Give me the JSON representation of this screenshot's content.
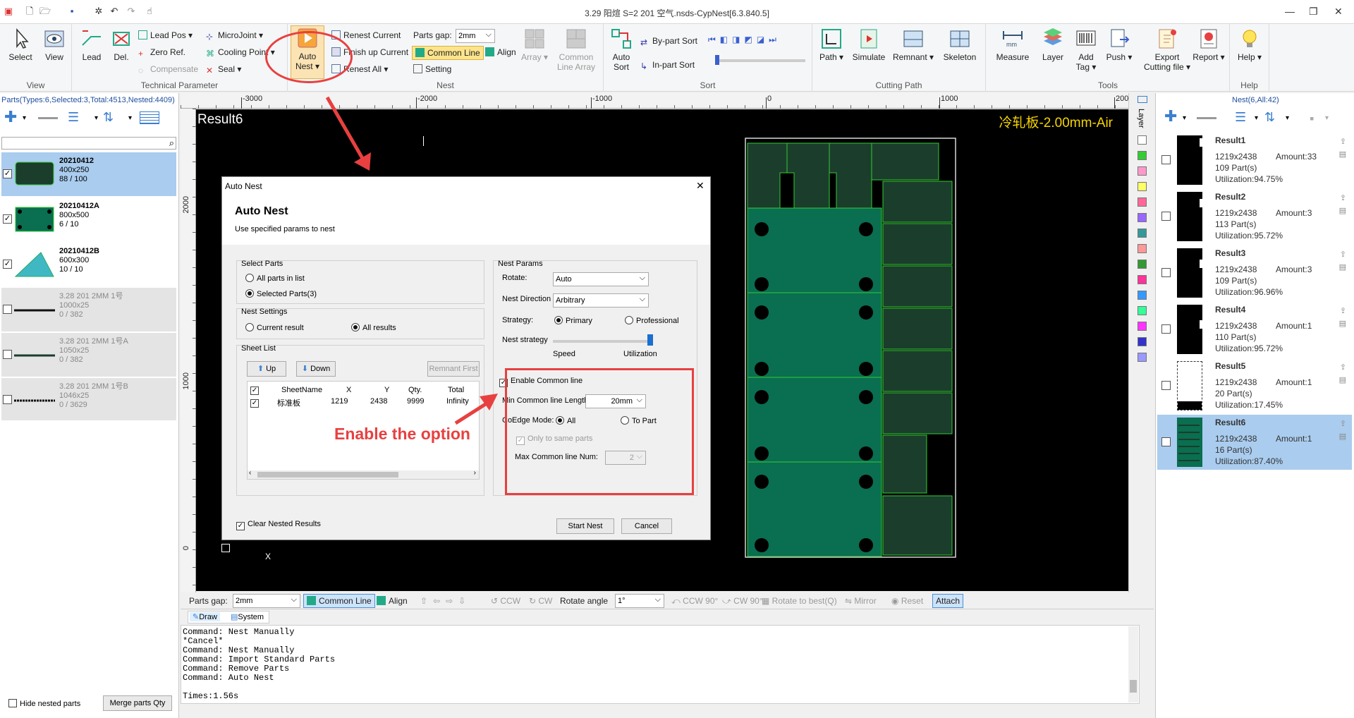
{
  "title": "3.29 阳煊 S=2 201 空气.nsds-CypNest[6.3.840.5]",
  "ribbon": {
    "view": {
      "label": "View",
      "select": "Select",
      "view": "View"
    },
    "tech": {
      "label": "Technical Parameter",
      "lead": "Lead",
      "del": "Del.",
      "lead_pos": "Lead Pos",
      "zero_ref": "Zero Ref.",
      "compensate": "Compensate",
      "microjoint": "MicroJoint",
      "cooling_point": "Cooling Point",
      "seal": "Seal"
    },
    "nest": {
      "label": "Nest",
      "auto_nest_1": "Auto",
      "auto_nest_2": "Nest",
      "renest_current": "Renest Current",
      "finish_up_current": "Finish up Current",
      "renest_all": "Renest All",
      "parts_gap_label": "Parts gap:",
      "parts_gap_value": "2mm",
      "common_line": "Common Line",
      "align": "Align",
      "setting": "Setting",
      "array": "Array",
      "common_line_array_1": "Common",
      "common_line_array_2": "Line Array"
    },
    "sort": {
      "label": "Sort",
      "auto_sort_1": "Auto",
      "auto_sort_2": "Sort",
      "by_part_sort": "By-part Sort",
      "in_part_sort": "In-part Sort"
    },
    "cutting": {
      "label": "Cutting Path",
      "path": "Path",
      "simulate": "Simulate",
      "remnant": "Remnant",
      "skeleton": "Skeleton"
    },
    "tools": {
      "label": "Tools",
      "measure": "Measure",
      "layer": "Layer",
      "add_tag_1": "Add",
      "add_tag_2": "Tag",
      "push": "Push",
      "export_1": "Export",
      "export_2": "Cutting file"
    },
    "report": {
      "report": "Report"
    },
    "help": {
      "label": "Help",
      "help": "Help"
    }
  },
  "left_panel": {
    "header": "Parts(Types:6,Selected:3,Total:4513,Nested:4409)",
    "parts": [
      {
        "name": "20210412",
        "size": "400x250",
        "count": "88 / 100",
        "checked": true,
        "selected": true
      },
      {
        "name": "20210412A",
        "size": "800x500",
        "count": "6 / 10",
        "checked": true,
        "selected": false
      },
      {
        "name": "20210412B",
        "size": "600x300",
        "count": "10 / 10",
        "checked": true,
        "selected": false
      },
      {
        "name": "3.28 201 2MM 1号",
        "size": "1000x25",
        "count": "0 / 382",
        "checked": false,
        "selected": false
      },
      {
        "name": "3.28 201 2MM 1号A",
        "size": "1050x25",
        "count": "0 / 382",
        "checked": false,
        "selected": false
      },
      {
        "name": "3.28 201 2MM 1号B",
        "size": "1046x25",
        "count": "0 / 3629",
        "checked": false,
        "selected": false
      }
    ],
    "hide_nested": "Hide nested parts",
    "merge_parts": "Merge parts Qty"
  },
  "canvas": {
    "result_label": "Result6",
    "material_label": "冷轧板-2.00mm-Air",
    "ruler_h": [
      "-3000",
      "-2000",
      "-1000",
      "0",
      "1000",
      "2000"
    ],
    "ruler_v": [
      "2000",
      "1000",
      "0"
    ],
    "axis_x": "X"
  },
  "annotation": {
    "text": "Enable the option"
  },
  "dialog": {
    "window_title": "Auto Nest",
    "heading": "Auto Nest",
    "subheading": "Use specified params to nest",
    "select_parts": {
      "title": "Select Parts",
      "all": "All parts in list",
      "selected": "Selected Parts(3)"
    },
    "nest_settings": {
      "title": "Nest Settings",
      "current": "Current result",
      "all": "All results"
    },
    "sheet_list": {
      "title": "Sheet List",
      "up": "Up",
      "down": "Down",
      "remnant_first": "Remnant First",
      "headers": [
        "SheetName",
        "X",
        "Y",
        "Qty.",
        "Total"
      ],
      "row": [
        "标准板",
        "1219",
        "2438",
        "9999",
        "Infinity"
      ]
    },
    "nest_params": {
      "title": "Nest Params",
      "rotate_label": "Rotate:",
      "rotate_value": "Auto",
      "direction_label": "Nest Direction",
      "direction_value": "Arbitrary",
      "strategy_label": "Strategy:",
      "primary": "Primary",
      "professional": "Professional",
      "nest_strategy": "Nest strategy",
      "speed": "Speed",
      "utilization": "Utilization"
    },
    "common_line": {
      "enable": "Enable Common line",
      "min_length_label": "Min Common line Length:",
      "min_length_value": "20mm",
      "coedge_label": "CoEdge Mode:",
      "all": "All",
      "to_part": "To Part",
      "only_same": "Only to same parts",
      "max_num_label": "Max Common line Num:",
      "max_num_value": "2"
    },
    "clear_nested": "Clear Nested Results",
    "start": "Start Nest",
    "cancel": "Cancel"
  },
  "bottom_toolbar": {
    "parts_gap_label": "Parts gap:",
    "parts_gap_value": "2mm",
    "common_line": "Common Line",
    "align": "Align",
    "ccw": "CCW",
    "cw": "CW",
    "rotate_angle_label": "Rotate angle",
    "rotate_angle_value": "1°",
    "ccw90": "CCW 90°",
    "cw90": "CW 90°",
    "rotate_best": "Rotate to best(Q)",
    "mirror": "Mirror",
    "reset": "Reset",
    "attach": "Attach"
  },
  "tabs": {
    "draw": "Draw",
    "system": "System"
  },
  "command_log": [
    "Command: Nest Manually",
    "*Cancel*",
    "Command: Nest Manually",
    "Command: Import Standard Parts",
    "Command: Remove Parts",
    "Command: Auto Nest",
    "",
    "Times:1.56s"
  ],
  "right_panel": {
    "header": "Nest(6,All:42)",
    "layer_label": "Layer",
    "results": [
      {
        "name": "Result1",
        "size": "1219x2438",
        "amount": "Amount:33",
        "parts": "109 Part(s)",
        "util": "Utilization:94.75%"
      },
      {
        "name": "Result2",
        "size": "1219x2438",
        "amount": "Amount:3",
        "parts": "113 Part(s)",
        "util": "Utilization:95.72%"
      },
      {
        "name": "Result3",
        "size": "1219x2438",
        "amount": "Amount:3",
        "parts": "109 Part(s)",
        "util": "Utilization:96.96%"
      },
      {
        "name": "Result4",
        "size": "1219x2438",
        "amount": "Amount:1",
        "parts": "110 Part(s)",
        "util": "Utilization:95.72%"
      },
      {
        "name": "Result5",
        "size": "1219x2438",
        "amount": "Amount:1",
        "parts": "20 Part(s)",
        "util": "Utilization:17.45%"
      },
      {
        "name": "Result6",
        "size": "1219x2438",
        "amount": "Amount:1",
        "parts": "16 Part(s)",
        "util": "Utilization:87.40%"
      }
    ],
    "layer_colors": [
      "#ffffff",
      "#33cc33",
      "#ff99cc",
      "#ffff66",
      "#ff6699",
      "#9966ff",
      "#339999",
      "#ff9999",
      "#339933",
      "#ff3399",
      "#3399ff",
      "#33ff99",
      "#ff33ff",
      "#3333cc",
      "#9999ff"
    ]
  },
  "colors": {
    "accent": "#e84040",
    "part_green": "#0a6e50",
    "part_dark": "#1b3d2c",
    "outline": "#33cc33",
    "selected": "#aaccee"
  }
}
